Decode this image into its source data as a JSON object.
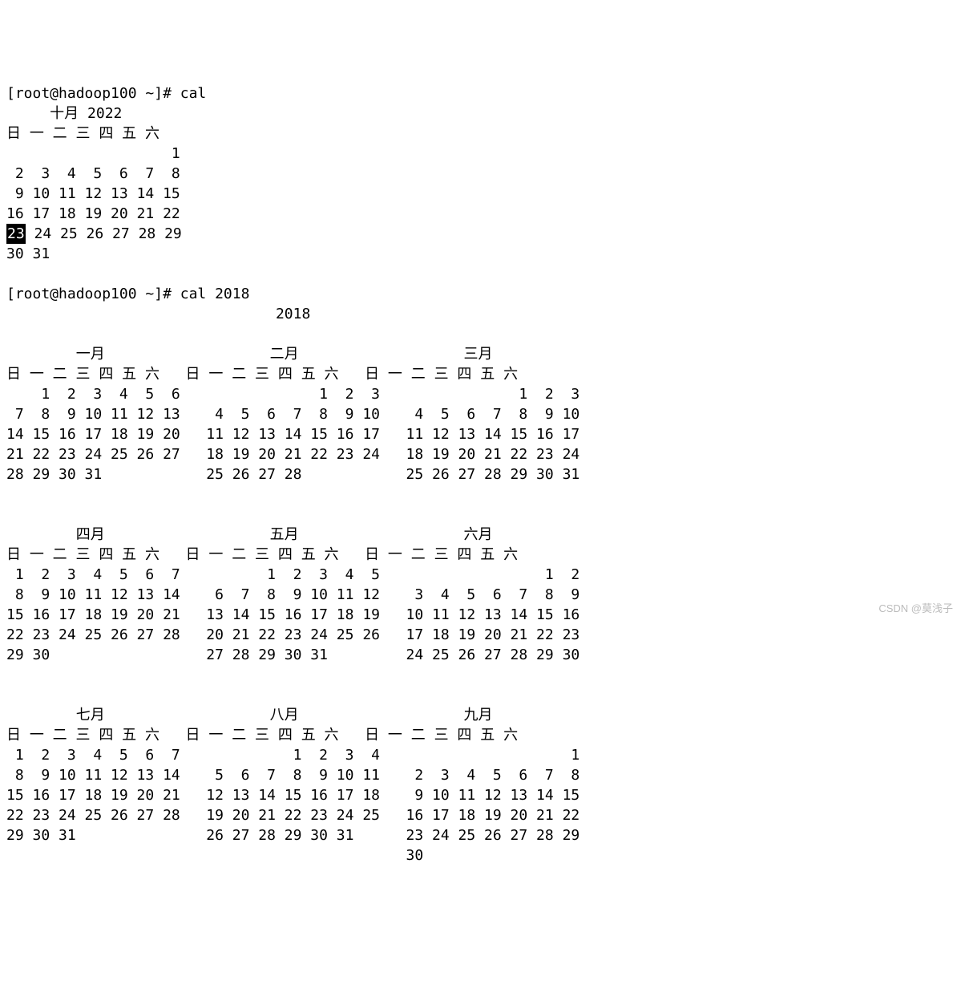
{
  "prompt1": {
    "text": "[root@hadoop100 ~]# ",
    "cmd": "cal"
  },
  "prompt2": {
    "text": "[root@hadoop100 ~]# ",
    "cmd": "cal 2018"
  },
  "cal1": {
    "title": "十月 2022",
    "dow": [
      "日",
      "一",
      "二",
      "三",
      "四",
      "五",
      "六"
    ],
    "grid": [
      [
        null,
        null,
        null,
        null,
        null,
        null,
        1
      ],
      [
        2,
        3,
        4,
        5,
        6,
        7,
        8
      ],
      [
        9,
        10,
        11,
        12,
        13,
        14,
        15
      ],
      [
        16,
        17,
        18,
        19,
        20,
        21,
        22
      ],
      [
        23,
        24,
        25,
        26,
        27,
        28,
        29
      ],
      [
        30,
        31,
        null,
        null,
        null,
        null,
        null
      ]
    ],
    "today": 23
  },
  "cal2": {
    "year": "2018",
    "dow": [
      "日",
      "一",
      "二",
      "三",
      "四",
      "五",
      "六"
    ],
    "months": [
      {
        "name": "一月",
        "start": 1,
        "days": 31
      },
      {
        "name": "二月",
        "start": 4,
        "days": 28
      },
      {
        "name": "三月",
        "start": 4,
        "days": 31
      },
      {
        "name": "四月",
        "start": 0,
        "days": 30
      },
      {
        "name": "五月",
        "start": 2,
        "days": 31
      },
      {
        "name": "六月",
        "start": 5,
        "days": 30
      },
      {
        "name": "七月",
        "start": 0,
        "days": 31
      },
      {
        "name": "八月",
        "start": 3,
        "days": 31
      },
      {
        "name": "九月",
        "start": 6,
        "days": 30
      }
    ]
  },
  "watermark": "CSDN @莫浅子",
  "chart_data": {
    "type": "table",
    "title": "cal / cal 2018 output",
    "calendar_single": {
      "month": "十月",
      "year": 2022,
      "highlighted_day": 23,
      "first_weekday": 6,
      "days_in_month": 31
    },
    "calendar_year": {
      "year": 2018,
      "months": [
        {
          "name": "一月",
          "first_weekday": 1,
          "days": 31
        },
        {
          "name": "二月",
          "first_weekday": 4,
          "days": 28
        },
        {
          "name": "三月",
          "first_weekday": 4,
          "days": 31
        },
        {
          "name": "四月",
          "first_weekday": 0,
          "days": 30
        },
        {
          "name": "五月",
          "first_weekday": 2,
          "days": 31
        },
        {
          "name": "六月",
          "first_weekday": 5,
          "days": 30
        },
        {
          "name": "七月",
          "first_weekday": 0,
          "days": 31
        },
        {
          "name": "八月",
          "first_weekday": 3,
          "days": 31
        },
        {
          "name": "九月",
          "first_weekday": 6,
          "days": 30
        }
      ]
    }
  }
}
